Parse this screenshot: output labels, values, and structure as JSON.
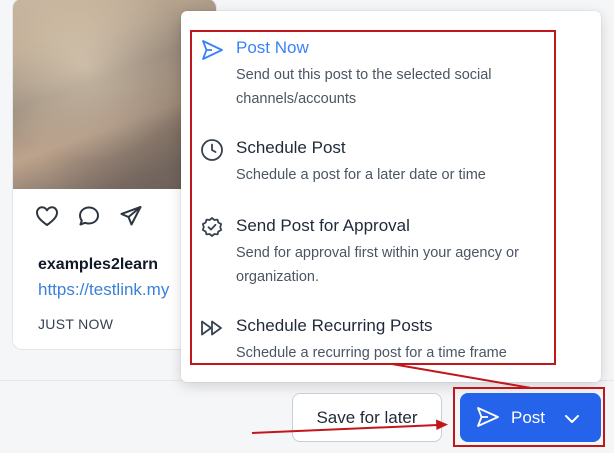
{
  "preview": {
    "username": "examples2learn",
    "link": "https://testlink.my",
    "timestamp": "JUST NOW"
  },
  "menu": {
    "items": [
      {
        "title": "Post Now",
        "description": "Send out this post to the selected social channels/accounts",
        "icon": "send-icon",
        "active": true
      },
      {
        "title": "Schedule Post",
        "description": "Schedule a post for a later date or time",
        "icon": "clock-icon"
      },
      {
        "title": "Send Post for Approval",
        "description": "Send for approval first within your agency or organization.",
        "icon": "badge-check-icon"
      },
      {
        "title": "Schedule Recurring Posts",
        "description": "Schedule a recurring post for a time frame",
        "icon": "fast-forward-icon"
      }
    ]
  },
  "footer": {
    "save_label": "Save for later",
    "post_label": "Post"
  },
  "colors": {
    "primary": "#2563eb",
    "active_item": "#3b82f6",
    "annotation": "#c0161c"
  }
}
